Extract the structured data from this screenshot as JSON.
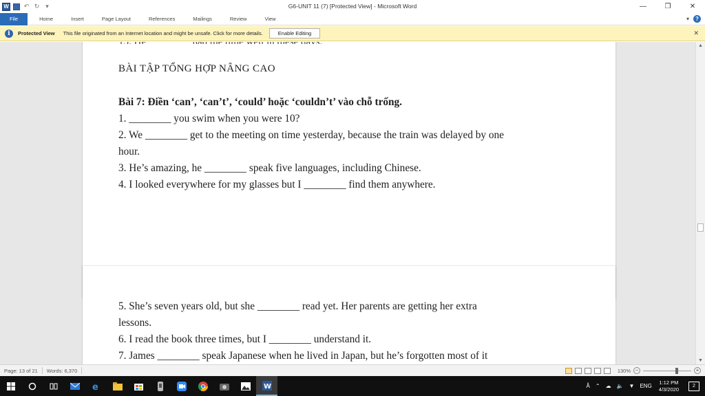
{
  "window": {
    "title": "G6-UNIT 11 (7) [Protected View]  -  Microsoft Word"
  },
  "ribbon": {
    "tabs": [
      "File",
      "Home",
      "Insert",
      "Page Layout",
      "References",
      "Mailings",
      "Review",
      "View"
    ]
  },
  "protected_view": {
    "title": "Protected View",
    "message": "This file originated from an Internet location and might be unsafe. Click for more details.",
    "button": "Enable Editing"
  },
  "document": {
    "page1": {
      "heading": "BÀI TẬP TỔNG HỢP NÂNG CAO",
      "exercise_title": "Bài 7: Điền ‘can’, ‘can’t’, ‘could’ hoặc ‘couldn’t’ vào chỗ trống.",
      "lines": [
        "1. ________ you swim when you were 10?",
        "2. We ________ get to the meeting on time yesterday, because the train was delayed by one",
        "hour.",
        "3. He’s amazing, he ________ speak five languages, including Chinese.",
        "4. I looked everywhere for my glasses but I ________ find them anywhere."
      ]
    },
    "page2": {
      "lines": [
        "5. She’s seven years old, but she ________ read yet. Her parents are getting her extra",
        "lessons.",
        "6. I read the book three times, but I ________ understand it.",
        "7. James ________ speak Japanese when he lived in Japan, but he’s forgotten most of it"
      ]
    }
  },
  "statusbar": {
    "page": "Page: 13 of 21",
    "words": "Words: 6,370",
    "zoom": "130%"
  },
  "taskbar": {
    "language": "ENG",
    "time": "1:12 PM",
    "date": "4/3/2020",
    "notifications": "2"
  }
}
